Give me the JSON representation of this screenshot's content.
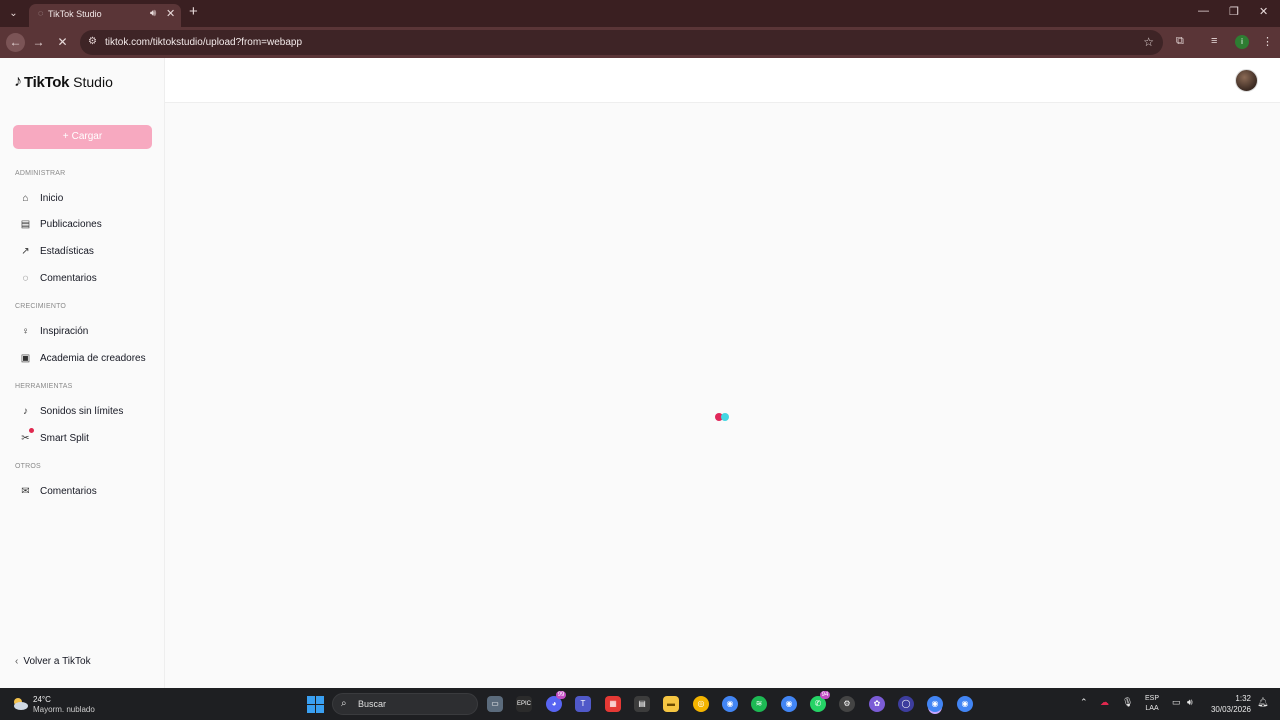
{
  "browser": {
    "tab_title": "TikTok Studio",
    "url": "tiktok.com/tiktokstudio/upload?from=webapp",
    "profile_initial": "i"
  },
  "studio": {
    "brand": "TikTok",
    "brand_suffix": "Studio",
    "upload_label": "Cargar",
    "sections": {
      "administrar": "ADMINISTRAR",
      "crecimiento": "CRECIMIENTO",
      "herramientas": "HERRAMIENTAS",
      "otros": "OTROS"
    },
    "nav": {
      "inicio": "Inicio",
      "publicaciones": "Publicaciones",
      "estadisticas": "Estadísticas",
      "comentarios": "Comentarios",
      "inspiracion": "Inspiración",
      "academia": "Academia de creadores",
      "sonidos": "Sonidos sin límites",
      "smart_split": "Smart Split",
      "otros_comentarios": "Comentarios"
    },
    "back_link": "Volver a TikTok"
  },
  "colors": {
    "upload_button": "#f7a9c0",
    "loader_red": "#e0285a",
    "loader_cyan": "#43d6e2",
    "browser_frame": "#3a1f21"
  },
  "taskbar": {
    "weather_temp": "24°C",
    "weather_desc": "Mayorm. nublado",
    "search_placeholder": "Buscar",
    "discord_badge": "99",
    "whatsapp_badge": "94",
    "lang_top": "ESP",
    "lang_bottom": "LAA",
    "time": "1:32",
    "date": "30/03/2026"
  }
}
